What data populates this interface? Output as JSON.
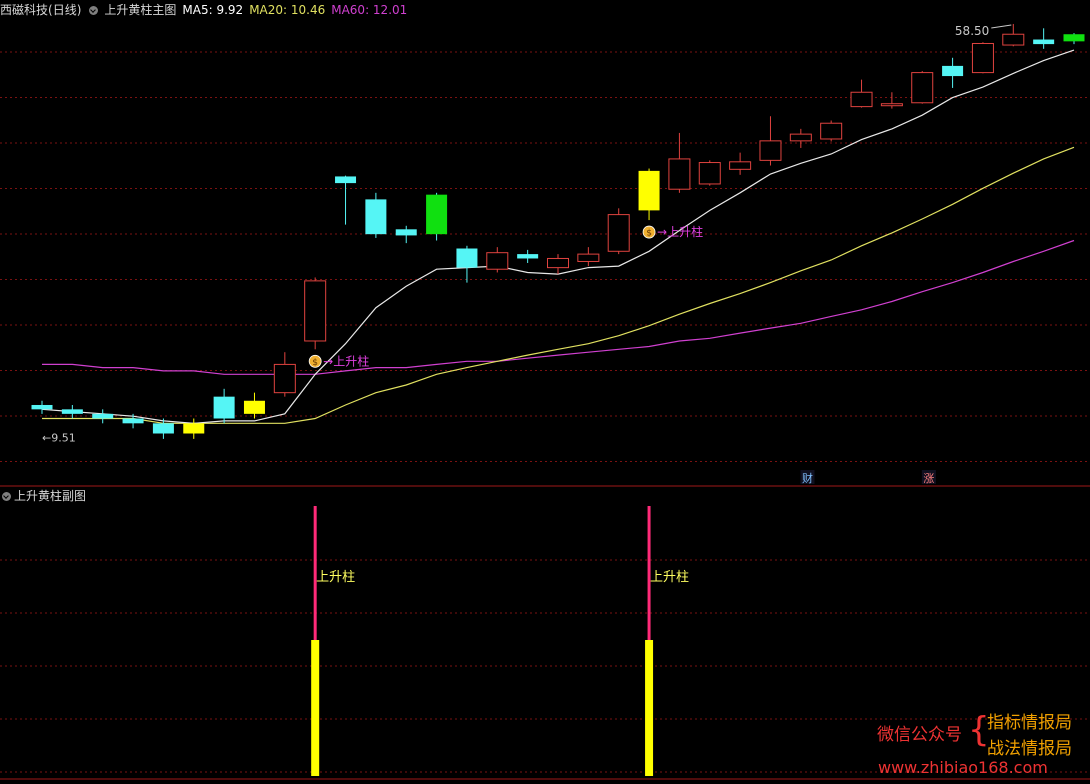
{
  "header": {
    "stock": "西磁科技",
    "period": "(日线)",
    "main_title": "上升黄柱主图",
    "ma5_label": "MA5: 9.92",
    "ma20_label": "MA20: 10.46",
    "ma60_label": "MA60: 12.01"
  },
  "colors": {
    "up": "#e0433f",
    "down_cyan": "#55f5f5",
    "down_green": "#10e010",
    "yellow": "#ffff00",
    "ma5": "#e8e8e8",
    "ma20": "#e0e060",
    "ma60": "#d040d0",
    "grid": "#7a1212",
    "signal": "#ff2a78"
  },
  "annotations": {
    "high_label": "58.50",
    "low_label": "9.51",
    "signal_label": "上升柱",
    "signal_label_1": "上升柱",
    "signal_label_2": "上升柱",
    "tag_cai": "财",
    "tag_zhang": "涨"
  },
  "sub": {
    "title": "上升黄柱副图",
    "bar_label": "上升柱",
    "bar_label_1": "上升柱",
    "bar_label_2": "上升柱"
  },
  "watermark": {
    "wechat": "微信公众号",
    "brace": "{",
    "line1": "指标情报局",
    "line2": "战法情报局",
    "site": "www.zhibiao168.com"
  },
  "chart_data": {
    "type": "candlestick",
    "price_range": [
      9.0,
      60.0
    ],
    "candles": [
      {
        "o": 10.4,
        "c": 10.3,
        "h": 10.5,
        "l": 10.2,
        "color": "cyan"
      },
      {
        "o": 10.3,
        "c": 10.2,
        "h": 10.4,
        "l": 10.1,
        "color": "cyan"
      },
      {
        "o": 10.2,
        "c": 10.1,
        "h": 10.3,
        "l": 10.0,
        "color": "cyan"
      },
      {
        "o": 10.1,
        "c": 10.0,
        "h": 10.2,
        "l": 9.9,
        "color": "cyan"
      },
      {
        "o": 10.0,
        "c": 9.8,
        "h": 10.1,
        "l": 9.7,
        "color": "cyan"
      },
      {
        "o": 10.0,
        "c": 9.8,
        "h": 10.1,
        "l": 9.7,
        "color": "yellow"
      },
      {
        "o": 10.6,
        "c": 10.1,
        "h": 10.8,
        "l": 10.0,
        "color": "cyan"
      },
      {
        "o": 10.5,
        "c": 10.2,
        "h": 10.7,
        "l": 10.1,
        "color": "yellow"
      },
      {
        "o": 10.7,
        "c": 11.5,
        "h": 11.9,
        "l": 10.6,
        "color": "up"
      },
      {
        "o": 12.3,
        "c": 15.1,
        "h": 15.3,
        "l": 12.0,
        "color": "up"
      },
      {
        "o": 24.1,
        "c": 23.3,
        "h": 24.2,
        "l": 19.1,
        "color": "cyan"
      },
      {
        "o": 21.5,
        "c": 18.3,
        "h": 22.2,
        "l": 18.0,
        "color": "cyan"
      },
      {
        "o": 18.7,
        "c": 18.2,
        "h": 19.0,
        "l": 17.6,
        "color": "cyan"
      },
      {
        "o": 22.0,
        "c": 18.3,
        "h": 22.2,
        "l": 17.8,
        "color": "green"
      },
      {
        "o": 17.2,
        "c": 15.9,
        "h": 17.4,
        "l": 15.0,
        "color": "cyan"
      },
      {
        "o": 15.8,
        "c": 16.9,
        "h": 17.3,
        "l": 15.6,
        "color": "up"
      },
      {
        "o": 16.8,
        "c": 16.5,
        "h": 17.1,
        "l": 16.2,
        "color": "cyan"
      },
      {
        "o": 15.9,
        "c": 16.5,
        "h": 16.8,
        "l": 15.5,
        "color": "up"
      },
      {
        "o": 16.3,
        "c": 16.8,
        "h": 17.3,
        "l": 16.0,
        "color": "up"
      },
      {
        "o": 17.0,
        "c": 20.0,
        "h": 20.6,
        "l": 16.8,
        "color": "up"
      },
      {
        "o": 24.8,
        "c": 20.4,
        "h": 25.1,
        "l": 19.5,
        "color": "yellow"
      },
      {
        "o": 22.6,
        "c": 26.4,
        "h": 30.4,
        "l": 22.2,
        "color": "up"
      },
      {
        "o": 23.2,
        "c": 25.9,
        "h": 26.2,
        "l": 23.0,
        "color": "up"
      },
      {
        "o": 25.0,
        "c": 26.0,
        "h": 27.3,
        "l": 24.3,
        "color": "up"
      },
      {
        "o": 26.2,
        "c": 29.1,
        "h": 33.4,
        "l": 25.5,
        "color": "up"
      },
      {
        "o": 29.1,
        "c": 30.2,
        "h": 31.1,
        "l": 28.0,
        "color": "up"
      },
      {
        "o": 29.4,
        "c": 32.1,
        "h": 32.6,
        "l": 29.0,
        "color": "up"
      },
      {
        "o": 35.3,
        "c": 38.4,
        "h": 41.4,
        "l": 35.1,
        "color": "up"
      },
      {
        "o": 35.5,
        "c": 35.9,
        "h": 38.4,
        "l": 34.9,
        "color": "up"
      },
      {
        "o": 36.1,
        "c": 43.2,
        "h": 43.6,
        "l": 35.9,
        "color": "up"
      },
      {
        "o": 45.0,
        "c": 42.3,
        "h": 47.3,
        "l": 39.4,
        "color": "cyan"
      },
      {
        "o": 43.2,
        "c": 51.7,
        "h": 52.1,
        "l": 43.0,
        "color": "up"
      },
      {
        "o": 51.2,
        "c": 54.8,
        "h": 58.5,
        "l": 50.8,
        "color": "up"
      },
      {
        "o": 53.0,
        "c": 51.5,
        "h": 56.9,
        "l": 50.0,
        "color": "cyan"
      },
      {
        "o": 52.4,
        "c": 54.8,
        "h": 55.2,
        "l": 51.5,
        "color": "green"
      }
    ],
    "ma5": [
      10.3,
      10.25,
      10.2,
      10.15,
      10.05,
      10.0,
      10.05,
      10.05,
      10.2,
      11.2,
      12.2,
      13.7,
      14.8,
      15.8,
      15.9,
      16.0,
      15.6,
      15.5,
      15.9,
      16.0,
      17.0,
      18.6,
      20.4,
      22.2,
      24.4,
      25.8,
      27.1,
      29.3,
      31.1,
      33.6,
      37.2,
      39.6,
      43.0,
      46.5,
      49.6
    ],
    "ma20": [
      10.1,
      10.1,
      10.1,
      10.1,
      10.0,
      10.0,
      10.0,
      10.0,
      10.0,
      10.1,
      10.4,
      10.7,
      10.9,
      11.2,
      11.4,
      11.6,
      11.8,
      12.0,
      12.2,
      12.5,
      12.9,
      13.4,
      13.9,
      14.4,
      15.0,
      15.7,
      16.4,
      17.4,
      18.4,
      19.6,
      21.0,
      22.7,
      24.5,
      26.4,
      28.1
    ],
    "ma60": [
      11.5,
      11.5,
      11.4,
      11.4,
      11.3,
      11.3,
      11.2,
      11.2,
      11.2,
      11.2,
      11.3,
      11.4,
      11.4,
      11.5,
      11.6,
      11.6,
      11.7,
      11.8,
      11.9,
      12.0,
      12.1,
      12.3,
      12.4,
      12.6,
      12.8,
      13.0,
      13.3,
      13.6,
      14.0,
      14.5,
      15.0,
      15.6,
      16.3,
      17.0,
      17.8
    ],
    "signals": [
      9,
      20
    ],
    "sub_signal_bars": [
      9,
      20
    ]
  }
}
